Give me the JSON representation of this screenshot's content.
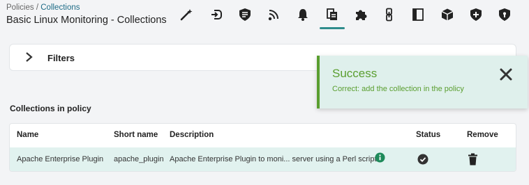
{
  "breadcrumb": {
    "parent": "Policies",
    "separator": "/",
    "current": "Collections"
  },
  "page_title": "Basic Linux Monitoring - Collections",
  "tabs": [
    {
      "icon": "wand-icon"
    },
    {
      "icon": "plug-icon"
    },
    {
      "icon": "shield-list-icon"
    },
    {
      "icon": "signal-icon"
    },
    {
      "icon": "bell-icon"
    },
    {
      "icon": "collections-icon",
      "active": true
    },
    {
      "icon": "puzzle-icon"
    },
    {
      "icon": "link-icon"
    },
    {
      "icon": "book-icon"
    },
    {
      "icon": "box-icon"
    },
    {
      "icon": "shield-plus-icon"
    },
    {
      "icon": "shield-lock-icon"
    }
  ],
  "filters": {
    "label": "Filters"
  },
  "section_title": "Collections in policy",
  "table": {
    "headers": {
      "name": "Name",
      "short_name": "Short name",
      "description": "Description",
      "status": "Status",
      "remove": "Remove"
    },
    "rows": [
      {
        "name": "Apache Enterprise Plugin",
        "short_name": "apache_plugin",
        "description": "Apache Enterprise Plugin to moni... server using a Perl script."
      }
    ]
  },
  "toast": {
    "title": "Success",
    "message": "Correct: add the collection in the policy",
    "color": "#5a9e2f"
  },
  "colors": {
    "accent": "#2e8c8c",
    "link": "#1d6b86",
    "row_highlight": "#e1f2ef"
  }
}
